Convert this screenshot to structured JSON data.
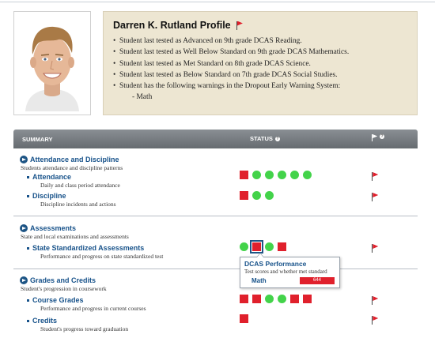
{
  "profile": {
    "name": "Darren K. Rutland Profile",
    "bullets": [
      "Student last tested as Advanced on 9th grade DCAS Reading.",
      "Student last tested as Well Below Standard on 9th grade DCAS Mathematics.",
      "Student last tested as Met Standard on 8th grade DCAS Science.",
      "Student last tested as Below Standard on 7th grade DCAS Social Studies.",
      "Student has the following warnings in the Dropout Early Warning System:"
    ],
    "warning_sub": "- Math"
  },
  "table_header": {
    "summary": "SUMMARY",
    "status": "STATUS",
    "help_glyph": "?"
  },
  "sections": {
    "attendance": {
      "title": "Attendance and Discipline",
      "desc": "Students attendance and discipline patterns",
      "items": {
        "attendance": {
          "title": "Attendance",
          "desc": "Daily and class period attendance",
          "status": [
            "red",
            "green",
            "green",
            "green",
            "green",
            "green"
          ]
        },
        "discipline": {
          "title": "Discipline",
          "desc": "Discipline incidents and actions",
          "status": [
            "red",
            "green",
            "green"
          ]
        }
      }
    },
    "assessments": {
      "title": "Assessments",
      "desc": "State and local examinations and assessments",
      "items": {
        "ssa": {
          "title": "State Standardized Assessments",
          "desc": "Performance and progress on state standardized test",
          "status": [
            "green",
            "red",
            "green",
            "red"
          ]
        }
      }
    },
    "grades": {
      "title": "Grades and Credits",
      "desc": "Student's progression in coursework",
      "items": {
        "course_grades": {
          "title": "Course Grades",
          "desc": "Performance and progress in current courses",
          "status": [
            "red",
            "red",
            "green",
            "green",
            "red",
            "red"
          ]
        },
        "credits": {
          "title": "Credits",
          "desc": "Student's progress toward graduation",
          "status": [
            "red"
          ]
        }
      }
    }
  },
  "tooltip": {
    "title": "DCAS Performance",
    "desc": "Test scores and whether met standard",
    "subject": "Math",
    "score": "644"
  },
  "colors": {
    "red": "#e0202c",
    "green": "#43d34a",
    "link_blue": "#17528a",
    "panel_bg": "#ede6d2"
  }
}
